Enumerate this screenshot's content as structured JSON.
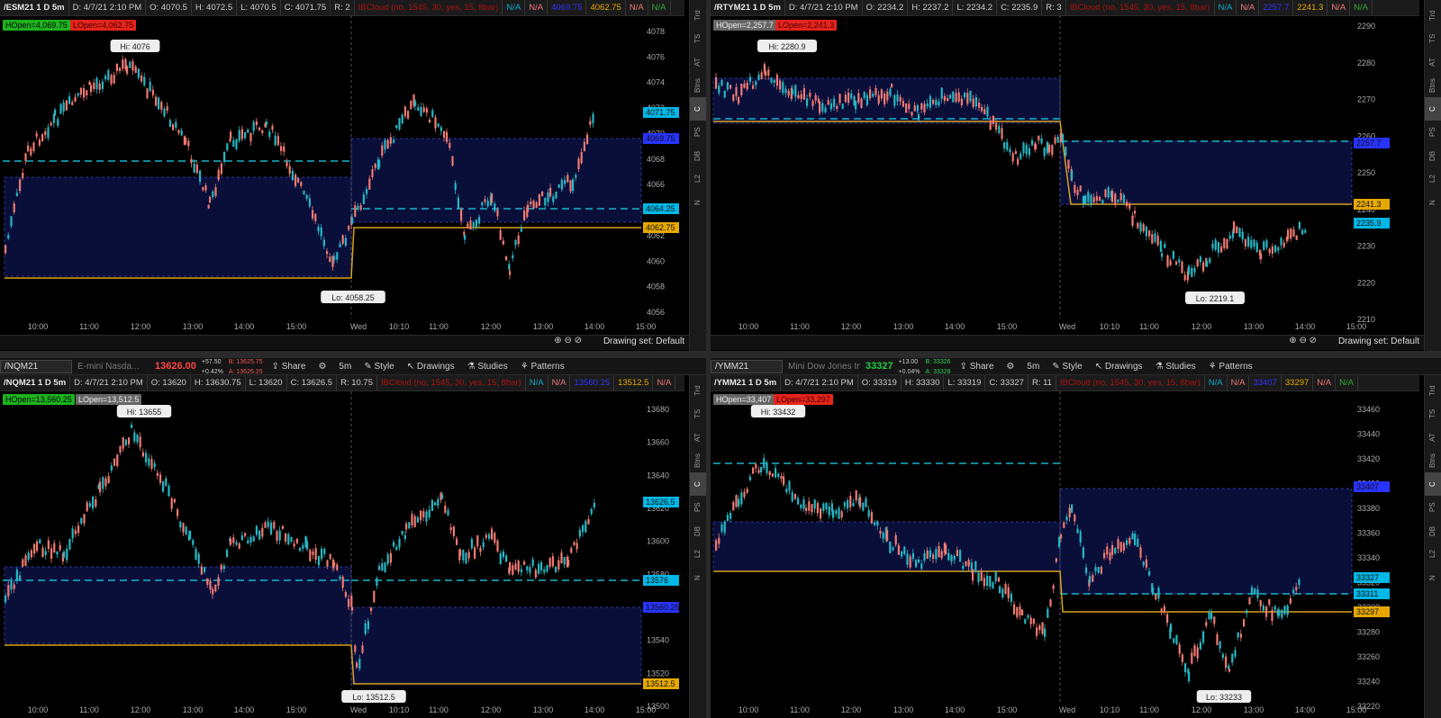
{
  "panels": [
    {
      "id": "es",
      "header": {
        "symbol": "/ESM21 1 D 5m",
        "date": "D: 4/7/21 2:10 PM",
        "open": "O: 4070.5",
        "high": "H: 4072.5",
        "low": "L: 4070.5",
        "close": "C: 4071.75",
        "range": "R: 2",
        "cloud": "IBCloud (no, 1545, 30, yes, 15, 8bar)",
        "v1": "N/A",
        "v2": "N/A",
        "v3": "4069.75",
        "v4": "4062.75",
        "v5": "N/A",
        "v6": "N/A"
      },
      "badges": {
        "hopen": "HOpen=4,069.75",
        "lopen": "LOpen=4,062.75"
      },
      "hi_label": "Hi: 4076",
      "lo_label": "Lo: 4058.25",
      "yaxis": [
        "4078",
        "4076",
        "4074",
        "4072",
        "4070",
        "4068",
        "4066",
        "4064",
        "4062",
        "4060",
        "4058",
        "4056"
      ],
      "xaxis": [
        "10:00",
        "11:00",
        "12:00",
        "13:00",
        "14:00",
        "15:00",
        "Wed",
        "10:10",
        "11:00",
        "12:00",
        "13:00",
        "14:00",
        "15:00"
      ],
      "price_tags": [
        {
          "text": "4071.75",
          "color": "#00b7e6"
        },
        {
          "text": "4069.75",
          "color": "#2733ff"
        },
        {
          "text": "4064.25",
          "color": "#00b7e6"
        },
        {
          "text": "4062.75",
          "color": "#e6a800"
        }
      ],
      "drawing_set": "Drawing set: Default"
    },
    {
      "id": "rty",
      "header": {
        "symbol": "/RTYM21 1 D 5m",
        "date": "D: 4/7/21 2:10 PM",
        "open": "O: 2234.2",
        "high": "H: 2237.2",
        "low": "L: 2234.2",
        "close": "C: 2235.9",
        "range": "R: 3",
        "cloud": "IBCloud (no, 1545, 30, yes, 15, 8bar)",
        "v1": "N/A",
        "v2": "N/A",
        "v3": "2257.7",
        "v4": "2241.3",
        "v5": "N/A",
        "v6": "N/A"
      },
      "badges": {
        "hopen": "HOpen=2,257.7",
        "lopen": "LOpen=2,241.3"
      },
      "hi_label": "Hi: 2280.9",
      "lo_label": "Lo: 2219.1",
      "yaxis": [
        "2290",
        "2280",
        "2270",
        "2260",
        "2250",
        "2240",
        "2230",
        "2220",
        "2210"
      ],
      "xaxis": [
        "10:00",
        "11:00",
        "12:00",
        "13:00",
        "14:00",
        "15:00",
        "Wed",
        "10:10",
        "11:00",
        "12:00",
        "13:00",
        "14:00",
        "15:00"
      ],
      "price_tags": [
        {
          "text": "2257.7",
          "color": "#2733ff"
        },
        {
          "text": "2241.3",
          "color": "#e6a800"
        },
        {
          "text": "2235.9",
          "color": "#00b7e6"
        }
      ],
      "drawing_set": "Drawing set: Default"
    },
    {
      "id": "nq",
      "toolbar": {
        "symbol": "/NQM21",
        "desc": "E-mini Nasda...",
        "price": "13626.00",
        "chg": "+57.50",
        "chgpct": "+0.42%",
        "bid": "B: 13625.75",
        "ask": "A: 13626.25",
        "share": "Share",
        "tf": "5m",
        "style": "Style",
        "drawings": "Drawings",
        "studies": "Studies",
        "patterns": "Patterns"
      },
      "header": {
        "symbol": "/NQM21 1 D 5m",
        "date": "D: 4/7/21 2:10 PM",
        "open": "O: 13620",
        "high": "H: 13630.75",
        "low": "L: 13620",
        "close": "C: 13626.5",
        "range": "R: 10.75",
        "cloud": "IBCloud (no, 1545, 30, yes, 15, 8bar)",
        "v1": "N/A",
        "v2": "N/A",
        "v3": "13560.25",
        "v4": "13512.5",
        "v5": "N/A",
        "v6": "N/A"
      },
      "badges": {
        "hopen": "HOpen=13,560.25",
        "lopen": "LOpen=13,512.5"
      },
      "hi_label": "Hi: 13655",
      "lo_label": "Lo: 13512.5",
      "yaxis": [
        "13680",
        "13660",
        "13640",
        "13620",
        "13600",
        "13580",
        "13560",
        "13540",
        "13520",
        "13500"
      ],
      "xaxis": [
        "10:00",
        "11:00",
        "12:00",
        "13:00",
        "14:00",
        "15:00",
        "Wed",
        "10:10",
        "11:00",
        "12:00",
        "13:00",
        "14:00",
        "15:00"
      ],
      "price_tags": [
        {
          "text": "13626.5",
          "color": "#00b7e6"
        },
        {
          "text": "13576",
          "color": "#00b7e6"
        },
        {
          "text": "13560.25",
          "color": "#2733ff"
        },
        {
          "text": "13512.5",
          "color": "#e6a800"
        }
      ]
    },
    {
      "id": "ym",
      "toolbar": {
        "symbol": "/YMM21",
        "desc": "Mini Dow Jones Ind...",
        "price": "33327",
        "chg": "+13.00",
        "chgpct": "+0.04%",
        "bid": "B: 33326",
        "ask": "A: 33328",
        "share": "Share",
        "tf": "5m",
        "style": "Style",
        "drawings": "Drawings",
        "studies": "Studies",
        "patterns": "Patterns"
      },
      "header": {
        "symbol": "/YMM21 1 D 5m",
        "date": "D: 4/7/21 2:10 PM",
        "open": "O: 33319",
        "high": "H: 33330",
        "low": "L: 33319",
        "close": "C: 33327",
        "range": "R: 11",
        "cloud": "IBCloud (no, 1545, 30, yes, 15, 8bar)",
        "v1": "N/A",
        "v2": "N/A",
        "v3": "33407",
        "v4": "33297",
        "v5": "N/A",
        "v6": "N/A"
      },
      "badges": {
        "hopen": "HOpen=33,407",
        "lopen": "LOpen=33,297"
      },
      "hi_label": "Hi: 33432",
      "lo_label": "Lo: 33233",
      "yaxis": [
        "33460",
        "33440",
        "33420",
        "33400",
        "33380",
        "33360",
        "33340",
        "33320",
        "33300",
        "33280",
        "33260",
        "33240",
        "33220"
      ],
      "xaxis": [
        "10:00",
        "11:00",
        "12:00",
        "13:00",
        "14:00",
        "15:00",
        "Wed",
        "10:10",
        "11:00",
        "12:00",
        "13:00",
        "14:00",
        "15:00"
      ],
      "price_tags": [
        {
          "text": "33407",
          "color": "#2733ff"
        },
        {
          "text": "33327",
          "color": "#00b7e6"
        },
        {
          "text": "33311",
          "color": "#00b7e6"
        },
        {
          "text": "33297",
          "color": "#e6a800"
        }
      ]
    }
  ],
  "sidebar_items": [
    "Trd",
    "TS",
    "AT",
    "Btns",
    "C",
    "PS",
    "DB",
    "L2",
    "N"
  ],
  "colors": {
    "up": "#26b7c4",
    "down": "#f07a72",
    "cloud": "#0a0f3a",
    "cyan": "#19b5c9",
    "gold": "#d9a21b",
    "hopen_bg": "#1db31d",
    "lopen_bg": "#e5241b"
  }
}
